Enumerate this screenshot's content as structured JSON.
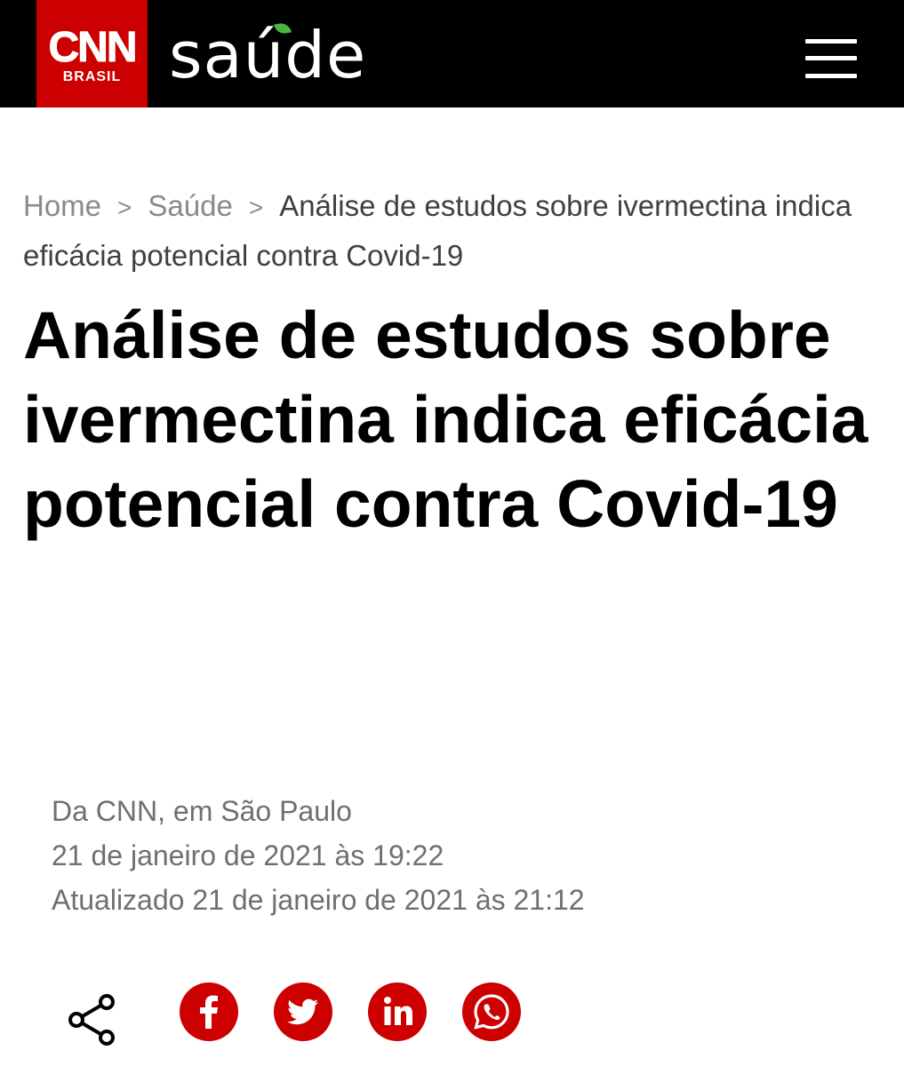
{
  "header": {
    "logo_main": "CNN",
    "logo_sub": "BRASIL",
    "section_name": "saúde",
    "menu_icon": "hamburger-menu-icon"
  },
  "breadcrumb": {
    "items": [
      {
        "label": "Home"
      },
      {
        "label": "Saúde"
      },
      {
        "label": "Análise de estudos sobre ivermectina indica eficácia potencial contra Covid-19"
      }
    ],
    "separator": ">"
  },
  "article": {
    "headline": "Análise de estudos sobre ivermectina indica eficácia potencial contra Covid-19",
    "byline": "Da CNN, em São Paulo",
    "published": "21 de janeiro de 2021 às 19:22",
    "updated": "Atualizado 21 de janeiro de 2021 às 21:12"
  },
  "share": {
    "share_icon": "share-icon",
    "networks": [
      "facebook-icon",
      "twitter-icon",
      "linkedin-icon",
      "whatsapp-icon"
    ],
    "brand_color": "#cc0000"
  }
}
